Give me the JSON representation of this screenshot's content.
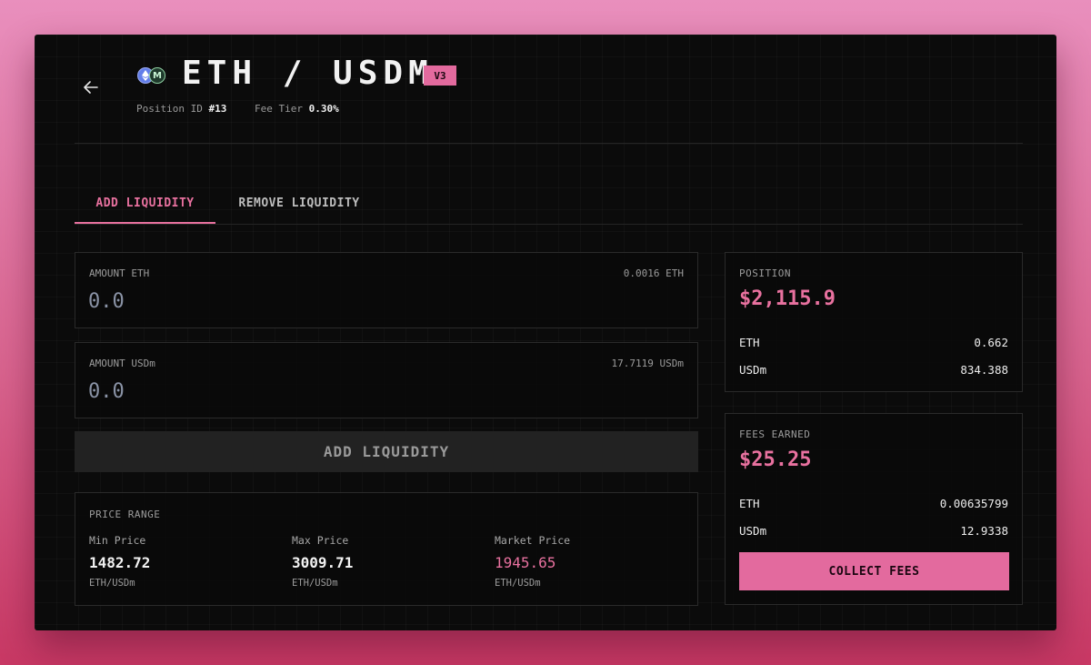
{
  "header": {
    "pair_title": "ETH / USDM",
    "version_badge": "V3",
    "position_id_label": "Position ID",
    "position_id_value": "#13",
    "fee_tier_label": "Fee Tier",
    "fee_tier_value": "0.30%",
    "token_icons": [
      "eth-icon",
      "usdm-icon"
    ],
    "token_icon_glyphs": {
      "usdm": "M"
    }
  },
  "tabs": [
    {
      "label": "ADD LIQUIDITY",
      "active": true
    },
    {
      "label": "REMOVE LIQUIDITY",
      "active": false
    }
  ],
  "inputs": {
    "eth": {
      "label": "AMOUNT ETH",
      "balance": "0.0016 ETH",
      "placeholder": "0.0"
    },
    "usdm": {
      "label": "AMOUNT USDm",
      "balance": "17.7119 USDm",
      "placeholder": "0.0"
    }
  },
  "add_button_label": "ADD LIQUIDITY",
  "price_range": {
    "title": "PRICE RANGE",
    "min": {
      "label": "Min Price",
      "value": "1482.72",
      "unit": "ETH/USDm"
    },
    "max": {
      "label": "Max Price",
      "value": "3009.71",
      "unit": "ETH/USDm"
    },
    "market": {
      "label": "Market Price",
      "value": "1945.65",
      "unit": "ETH/USDm"
    }
  },
  "position": {
    "title": "POSITION",
    "total": "$2,115.9",
    "rows": [
      {
        "token": "ETH",
        "amount": "0.662"
      },
      {
        "token": "USDm",
        "amount": "834.388"
      }
    ]
  },
  "fees": {
    "title": "FEES EARNED",
    "total": "$25.25",
    "rows": [
      {
        "token": "ETH",
        "amount": "0.00635799"
      },
      {
        "token": "USDm",
        "amount": "12.9338"
      }
    ],
    "collect_label": "COLLECT FEES"
  },
  "colors": {
    "accent": "#e36a9e",
    "background": "#0b0b0b",
    "card_border": "#2a2a2a"
  }
}
